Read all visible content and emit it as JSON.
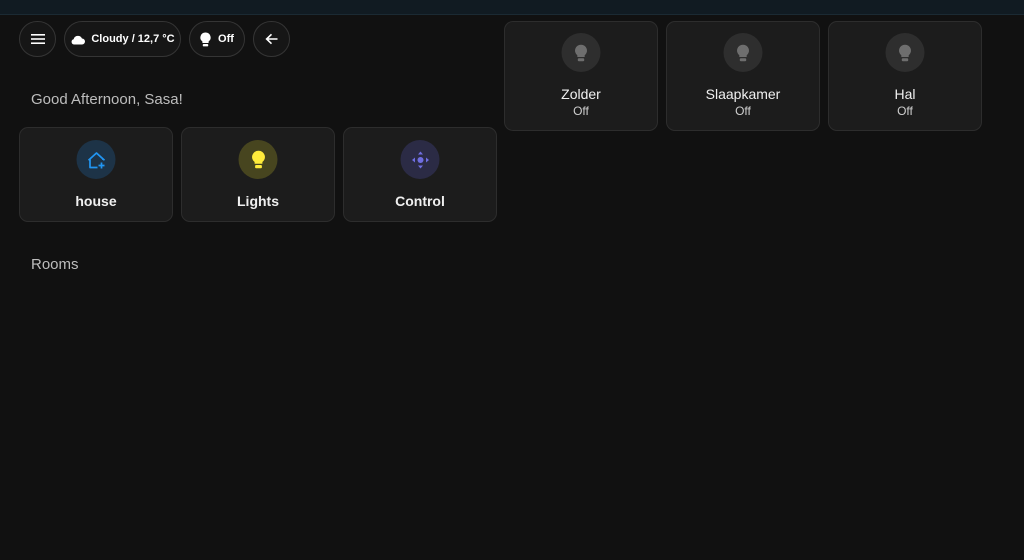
{
  "header": {
    "menu_icon": "menu-icon",
    "weather": {
      "icon": "cloud-icon",
      "label": "Cloudy / 12,7 °C"
    },
    "lights": {
      "icon": "lightbulb-icon",
      "label": "Off"
    },
    "back_icon": "arrow-left-icon"
  },
  "greeting": "Good Afternoon, Sasa!",
  "nav_cards": [
    {
      "label": "house",
      "icon": "home-plus-icon",
      "color": "#2196f3",
      "bg": "#1d3347"
    },
    {
      "label": "Lights",
      "icon": "lightbulb-icon",
      "color": "#ffeb3b",
      "bg": "#47451f"
    },
    {
      "label": "Control",
      "icon": "control-pad-icon",
      "color": "#6f6ee0",
      "bg": "#2b2b45"
    }
  ],
  "rooms_section": {
    "title": "Rooms"
  },
  "room_cards": [
    {
      "name": "Zolder",
      "state": "Off",
      "icon": "lightbulb-icon"
    },
    {
      "name": "Slaapkamer",
      "state": "Off",
      "icon": "lightbulb-icon"
    },
    {
      "name": "Hal",
      "state": "Off",
      "icon": "lightbulb-icon"
    }
  ],
  "colors": {
    "background": "#111111",
    "card": "#1c1c1c",
    "bulb_off": "#6e6e6e"
  }
}
